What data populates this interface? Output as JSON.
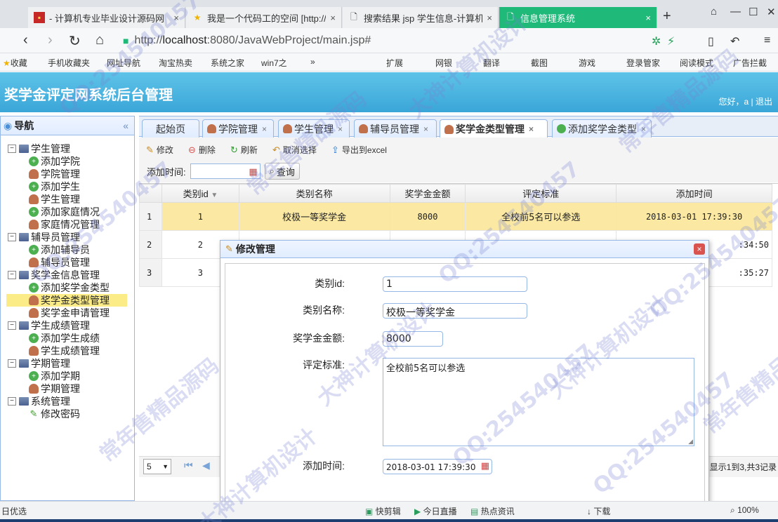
{
  "browser": {
    "tabs": [
      {
        "label": "- 计算机专业毕业设计源码网",
        "active": false
      },
      {
        "label": "我是一个代码工的空间 [http://",
        "active": false
      },
      {
        "label": "搜索结果 jsp 学生信息-计算机",
        "active": false
      },
      {
        "label": "信息管理系统",
        "active": true
      }
    ],
    "url_prefix": "http://",
    "url_host": "localhost",
    "url_rest": ":8080/JavaWebProject/main.jsp#",
    "bookmarks": [
      "收藏",
      "手机收藏夹",
      "网址导航",
      "淘宝热卖",
      "系统之家",
      "win7之",
      "扩展",
      "网银",
      "翻译",
      "截图",
      "游戏",
      "登录管家",
      "阅读模式",
      "广告拦截"
    ]
  },
  "app": {
    "title": "奖学金评定网系统后台管理",
    "greeting": "您好，a",
    "separator": "|",
    "logout": "退出"
  },
  "sidebar": {
    "title": "导航",
    "collapse": "«",
    "groups": [
      {
        "label": "学生管理",
        "items": [
          {
            "label": "添加学院",
            "icon": "add"
          },
          {
            "label": "学院管理",
            "icon": "person"
          },
          {
            "label": "添加学生",
            "icon": "add"
          },
          {
            "label": "学生管理",
            "icon": "person"
          },
          {
            "label": "添加家庭情况",
            "icon": "add"
          },
          {
            "label": "家庭情况管理",
            "icon": "person"
          }
        ]
      },
      {
        "label": "辅导员管理",
        "items": [
          {
            "label": "添加辅导员",
            "icon": "add"
          },
          {
            "label": "辅导员管理",
            "icon": "person"
          }
        ]
      },
      {
        "label": "奖学金信息管理",
        "items": [
          {
            "label": "添加奖学金类型",
            "icon": "add"
          },
          {
            "label": "奖学金类型管理",
            "icon": "person",
            "selected": true
          },
          {
            "label": "奖学金申请管理",
            "icon": "person"
          }
        ]
      },
      {
        "label": "学生成绩管理",
        "items": [
          {
            "label": "添加学生成绩",
            "icon": "add"
          },
          {
            "label": "学生成绩管理",
            "icon": "person"
          }
        ]
      },
      {
        "label": "学期管理",
        "items": [
          {
            "label": "添加学期",
            "icon": "add"
          },
          {
            "label": "学期管理",
            "icon": "person"
          }
        ]
      },
      {
        "label": "系统管理",
        "items": [
          {
            "label": "修改密码",
            "icon": "pen"
          }
        ]
      }
    ]
  },
  "tabs": [
    {
      "label": "起始页",
      "closable": false
    },
    {
      "label": "学院管理",
      "closable": true
    },
    {
      "label": "学生管理",
      "closable": true
    },
    {
      "label": "辅导员管理",
      "closable": true
    },
    {
      "label": "奖学金类型管理",
      "closable": true,
      "active": true
    },
    {
      "label": "添加奖学金类型",
      "closable": true
    }
  ],
  "toolbar": {
    "edit": "修改",
    "delete": "删除",
    "refresh": "刷新",
    "cancel_select": "取消选择",
    "export": "导出到excel",
    "date_label": "添加时间:",
    "query": "查询"
  },
  "grid": {
    "columns": [
      "类别id",
      "类别名称",
      "奖学金金额",
      "评定标准",
      "添加时间"
    ],
    "rows": [
      {
        "rownum": "1",
        "id": "1",
        "name": "校极一等奖学金",
        "amount": "8000",
        "criteria": "全校前5名可以参选",
        "time": "2018-03-01 17:39:30",
        "selected": true
      },
      {
        "rownum": "2",
        "id": "2",
        "time_tail": ":34:50"
      },
      {
        "rownum": "3",
        "id": "3",
        "time_tail": ":35:27"
      }
    ]
  },
  "pager": {
    "page_size": "5",
    "info": "显示1到3,共3记录"
  },
  "modal": {
    "title": "修改管理",
    "close": "×",
    "fields": {
      "id_label": "类别id:",
      "id_value": "1",
      "name_label": "类别名称:",
      "name_value": "校极一等奖学金",
      "amount_label": "奖学金金额:",
      "amount_value": "8000",
      "criteria_label": "评定标准:",
      "criteria_value": "全校前5名可以参选",
      "time_label": "添加时间:",
      "time_value": "2018-03-01 17:39:30"
    }
  },
  "statusbar": {
    "left": "日优选",
    "items": [
      "快剪辑",
      "今日直播",
      "热点资讯",
      "下载",
      "100%"
    ]
  },
  "watermarks": [
    "QQ:254540457",
    "大神计算机设计",
    "常年售精品源码"
  ]
}
